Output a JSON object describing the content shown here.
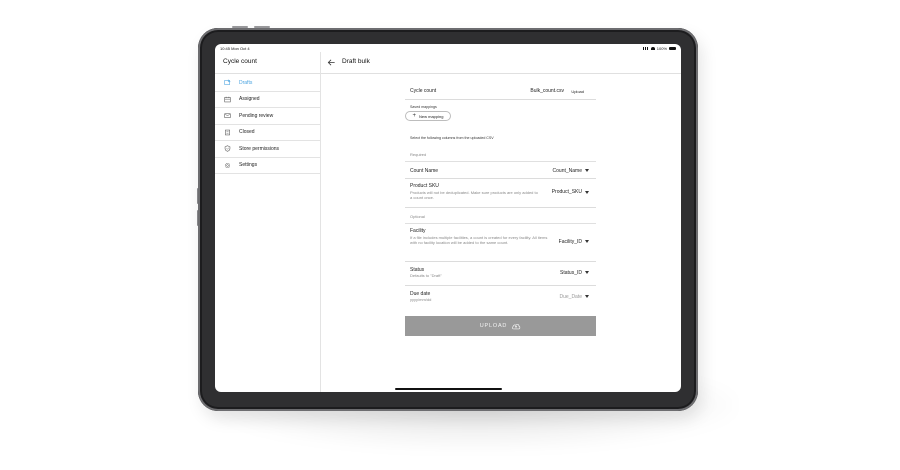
{
  "status": {
    "time": "10:45  Mon Oct 4",
    "battery": "100%"
  },
  "sidebar": {
    "title": "Cycle count",
    "items": [
      {
        "label": "Drafts",
        "icon": "drafts-icon",
        "active": true
      },
      {
        "label": "Assigned",
        "icon": "assigned-icon",
        "active": false
      },
      {
        "label": "Pending review",
        "icon": "mail-icon",
        "active": false
      },
      {
        "label": "Closed",
        "icon": "closed-icon",
        "active": false
      },
      {
        "label": "Store permissions",
        "icon": "shield-icon",
        "active": false
      },
      {
        "label": "Settings",
        "icon": "gear-icon",
        "active": false
      }
    ]
  },
  "main": {
    "title": "Draft bulk",
    "file": {
      "label": "Cycle count",
      "filename": "Bulk_count.csv",
      "action": "Upload"
    },
    "saved_mappings_label": "Saved mappings",
    "new_mapping_label": "New mapping",
    "instruction": "Select the following columns from the uploaded CSV",
    "required_label": "Required",
    "optional_label": "Optional",
    "fields": {
      "count_name": {
        "label": "Count Name",
        "value": "Count_Name"
      },
      "product_sku": {
        "label": "Product SKU",
        "description": "Products will not be deduplicated. Make sure products are only added to a count once.",
        "value": "Product_SKU"
      },
      "facility": {
        "label": "Facility",
        "description": "If a file includes multiple facilities, a count is created for every facility. All items with no facility location will be added to the same count.",
        "value": "Facility_ID"
      },
      "status": {
        "label": "Status",
        "description": "Defaults to \"Draft\"",
        "value": "Status_ID"
      },
      "due_date": {
        "label": "Due date",
        "description": "yyyy/mm/dd",
        "value": "Due_Date"
      }
    },
    "upload_button": "UPLOAD"
  },
  "colors": {
    "accent": "#4aa3e0",
    "button": "#999999",
    "device": "#2f2f31"
  }
}
